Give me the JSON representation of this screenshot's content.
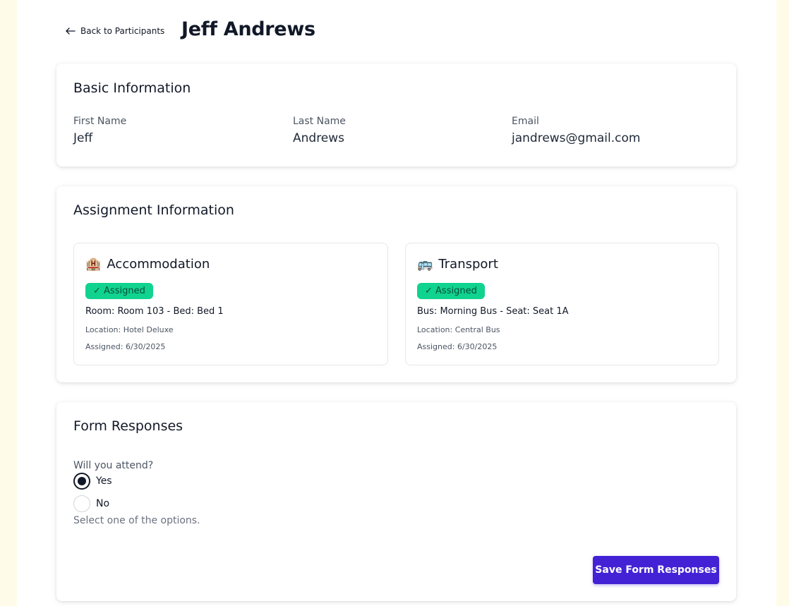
{
  "header": {
    "back_label": "Back to Participants",
    "title": "Jeff Andrews"
  },
  "basic_info": {
    "title": "Basic Information",
    "fields": [
      {
        "label": "First Name",
        "value": "Jeff"
      },
      {
        "label": "Last Name",
        "value": "Andrews"
      },
      {
        "label": "Email",
        "value": "jandrews@gmail.com"
      }
    ]
  },
  "assignment_info": {
    "title": "Assignment Information",
    "accommodation": {
      "icon": "hotel-icon",
      "emoji": "🏨",
      "title": "Accommodation",
      "badge": "✓ Assigned",
      "detail": "Room: Room 103 - Bed: Bed 1",
      "location": "Location: Hotel Deluxe",
      "assigned": "Assigned: 6/30/2025"
    },
    "transport": {
      "icon": "bus-icon",
      "emoji": "🚌",
      "title": "Transport",
      "badge": "✓ Assigned",
      "detail": "Bus: Morning Bus - Seat: Seat 1A",
      "location": "Location: Central Bus",
      "assigned": "Assigned: 6/30/2025"
    }
  },
  "form_responses": {
    "title": "Form Responses",
    "question": "Will you attend?",
    "options": [
      {
        "label": "Yes",
        "selected": true
      },
      {
        "label": "No",
        "selected": false
      }
    ],
    "hint": "Select one of the options.",
    "save_label": "Save Form Responses"
  },
  "colors": {
    "page_background": "#fefce8",
    "badge_green": "#10d38f",
    "primary_button": "#4322d6"
  }
}
